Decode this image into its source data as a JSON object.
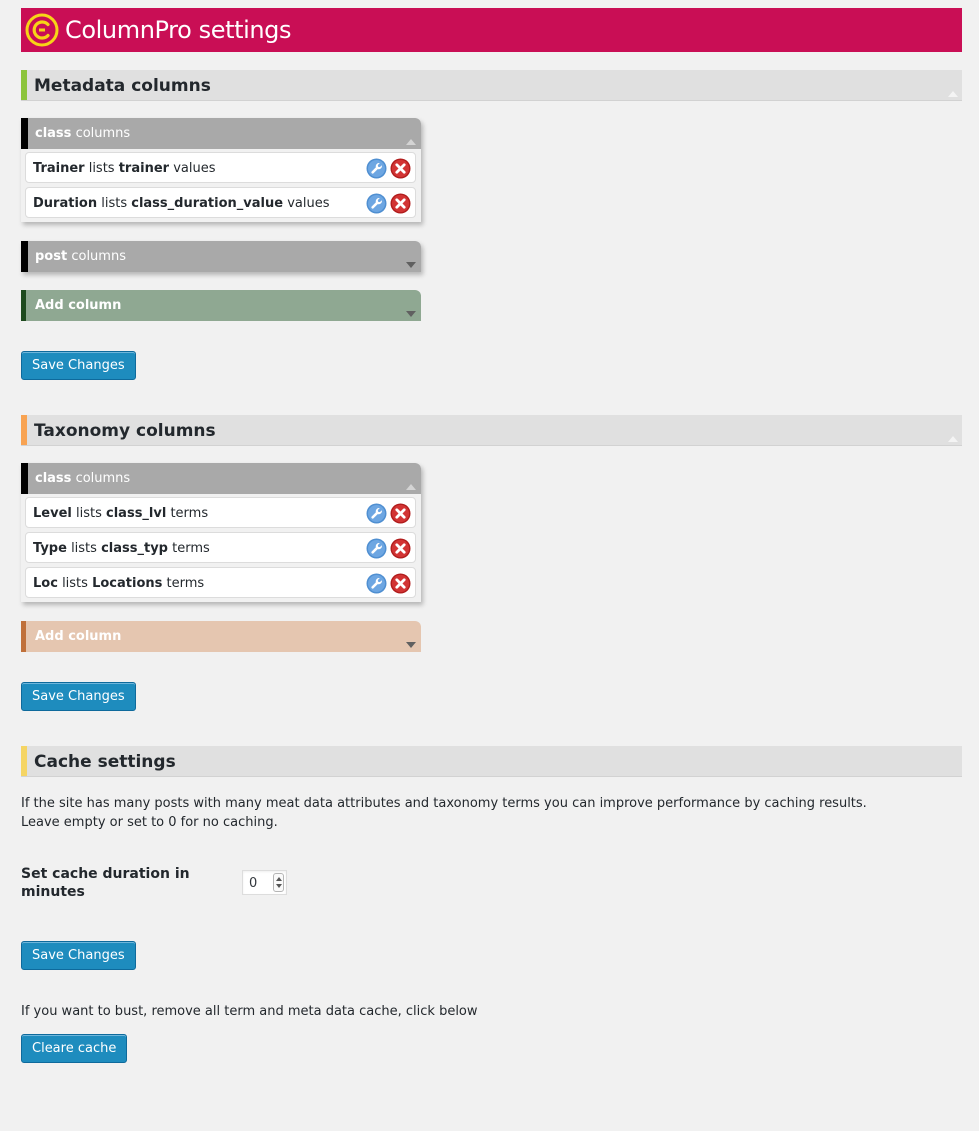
{
  "header": {
    "title": "ColumnPro settings",
    "brand_color": "#c90e55"
  },
  "metadata": {
    "title": "Metadata columns",
    "accent": "#8cc43c",
    "groups": [
      {
        "name": "class",
        "suffix": "columns",
        "items": [
          {
            "label": "Trainer",
            "mid": "lists",
            "key": "trainer",
            "unit": "values"
          },
          {
            "label": "Duration",
            "mid": "lists",
            "key": "class_duration_value",
            "unit": "values"
          }
        ]
      },
      {
        "name": "post",
        "suffix": "columns"
      }
    ],
    "add_label": "Add column",
    "add_color": "#8fa892",
    "save_label": "Save Changes"
  },
  "taxonomy": {
    "title": "Taxonomy columns",
    "accent": "#f8a352",
    "groups": [
      {
        "name": "class",
        "suffix": "columns",
        "items": [
          {
            "label": "Level",
            "mid": "lists",
            "key": "class_lvl",
            "unit": "terms"
          },
          {
            "label": "Type",
            "mid": "lists",
            "key": "class_typ",
            "unit": "terms"
          },
          {
            "label": "Loc",
            "mid": "lists",
            "key": "Locations",
            "unit": "terms"
          }
        ]
      }
    ],
    "add_label": "Add column",
    "add_color": "#e5c6b0",
    "save_label": "Save Changes"
  },
  "cache": {
    "title": "Cache settings",
    "accent": "#f5d564",
    "desc_line1": "If the site has many posts with many meat data attributes and taxonomy terms you can improve performance by caching results.",
    "desc_line2": "Leave empty or set to 0 for no caching.",
    "duration_label": "Set cache duration in minutes",
    "duration_value": "0",
    "save_label": "Save Changes",
    "bust_text": "If you want to bust, remove all term and meta data cache, click below",
    "clear_label": "Cleare cache"
  },
  "icons": {
    "edit": "wrench-icon",
    "delete": "close-circle-icon",
    "logo": "columnpro-logo-icon"
  }
}
